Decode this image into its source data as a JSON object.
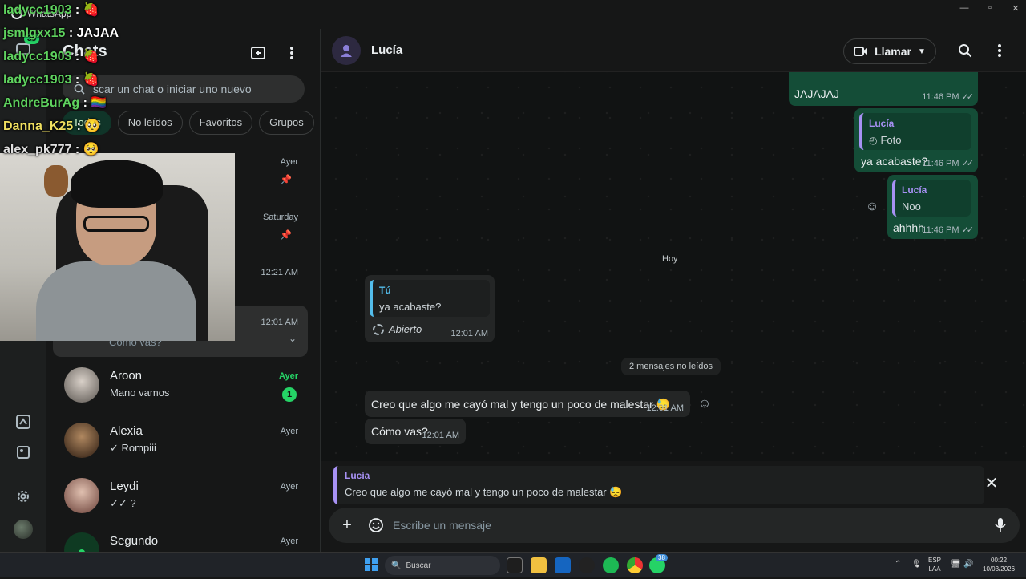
{
  "window": {
    "app_title": "WhatsApp"
  },
  "stream_chat": [
    {
      "user": "ladycc1903",
      "text": ": 🍓",
      "color": "#5fd35f"
    },
    {
      "user": "jsmlgxx15",
      "text": ": JAJAA",
      "color": "#5fd35f"
    },
    {
      "user": "ladycc1903",
      "text": ": 🍓",
      "color": "#5fd35f"
    },
    {
      "user": "ladycc1903",
      "text": ": 🍓",
      "color": "#5fd35f"
    },
    {
      "user": "AndreBurAg",
      "text": ": 🏳️‍🌈",
      "color": "#5fd35f"
    },
    {
      "user": "Danna_K25",
      "text": ": 🥺",
      "color": "#f0e060"
    },
    {
      "user": "alex_pk777",
      "text": ": 🥺",
      "color": "#e0e0e0"
    }
  ],
  "rail": {
    "badge": "38"
  },
  "sidebar": {
    "title": "Chats",
    "search_placeholder": "Buscar un chat o iniciar uno nuevo",
    "search_visible": "scar un chat o iniciar uno nuevo",
    "chips": [
      "Todos",
      "No leídos",
      "Favoritos",
      "Grupos"
    ],
    "hidden_times": [
      "Ayer",
      "Saturday",
      "12:21 AM",
      "12:01 AM"
    ],
    "chats": [
      {
        "name": "Aroon",
        "last": "Mano vamos",
        "time": "Ayer",
        "unread": "1"
      },
      {
        "name": "Alexia",
        "last": "✓ Rompiii",
        "time": "Ayer"
      },
      {
        "name": "Leydi",
        "last": "✓✓ ?",
        "time": "Ayer"
      },
      {
        "name": "Segundo",
        "last": "",
        "time": "Ayer"
      }
    ],
    "selected_partial": "Cómo vas?"
  },
  "chat": {
    "name": "Lucía",
    "call_label": "Llamar",
    "messages": {
      "m1": {
        "text": "JAJAJAJ",
        "time": "11:46 PM"
      },
      "m2": {
        "quote_name": "Lucía",
        "quote_text": "Foto",
        "text": "ya acabaste?",
        "time": "11:46 PM"
      },
      "m3": {
        "quote_name": "Lucía",
        "quote_text": "Noo",
        "text": "ahhhh",
        "time": "11:46 PM"
      },
      "day": "Hoy",
      "m4": {
        "quote_name": "Tú",
        "quote_text": "ya acabaste?",
        "text": "Abierto",
        "time": "12:01 AM"
      },
      "unread_pill": "2 mensajes no leídos",
      "m5": {
        "text": "Creo que algo me cayó mal y tengo un poco de malestar 😓",
        "time": "12:01 AM"
      },
      "m6": {
        "text": "Cómo vas?",
        "time": "12:01 AM"
      }
    },
    "reply": {
      "name": "Lucía",
      "text": "Creo que algo me cayó mal y tengo un poco de malestar 😓"
    },
    "composer_placeholder": "Escribe un mensaje"
  },
  "taskbar": {
    "search": "Buscar",
    "lang_top": "ESP",
    "lang_bottom": "LAA",
    "time": "00:22",
    "date": "10/03/2026",
    "whatsapp_badge": "38"
  },
  "colors": {
    "accent": "#25d366",
    "outgoing": "#144d37",
    "incoming": "#242626",
    "quote": "#a791f4"
  }
}
